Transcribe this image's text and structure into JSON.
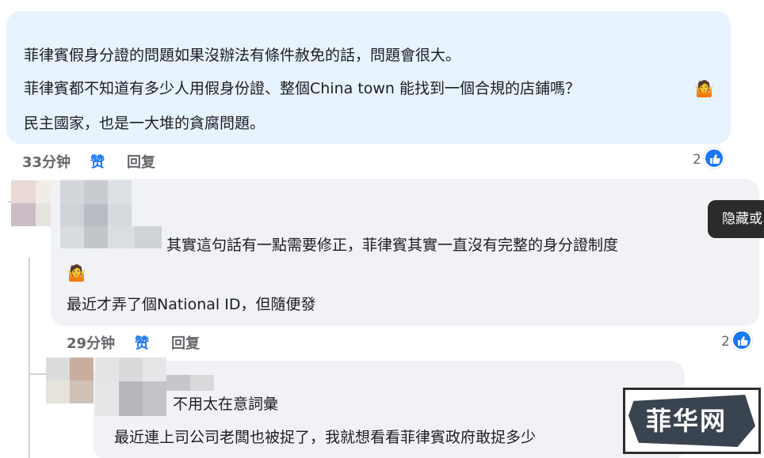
{
  "comment1": {
    "lines": [
      "菲律賓假身分證的問題如果沒辦法有條件￼赦免的話，問題會很大。",
      "菲律賓都不知道有多少人用假身份證、整個China town 能找到一個合規的店鋪嗎？",
      "民主國家，也是一大堆的貪腐問題￼。"
    ],
    "time": "33分钟",
    "like_label": "赞",
    "reply_label": "回复",
    "reaction_count": "2"
  },
  "comment2": {
    "lines": [
      "其實這句話有一點需要修正，菲律賓其實一直沒有完整的身分證制度",
      "最近才弄了個National ID，但隨便發"
    ],
    "time": "29分钟",
    "like_label": "赞",
    "reply_label": "回复",
    "reaction_count": "2"
  },
  "comment3": {
    "lines": [
      "不用太在意詞彙",
      "最近連上司公司老闆也被捉了，我就想看看菲律賓政府敢捉多少"
    ]
  },
  "hide_chip": {
    "label": "隐藏或"
  },
  "watermark": {
    "text": "菲华网"
  },
  "icons": {
    "like": "thumbs-up-icon",
    "emoji": "person-shrugging-emoji"
  },
  "colors": {
    "accent": "#1877f2",
    "own_bubble": "#e7f3ff",
    "reply_bubble": "#f0f2f5",
    "meta_gray": "#65676b"
  }
}
